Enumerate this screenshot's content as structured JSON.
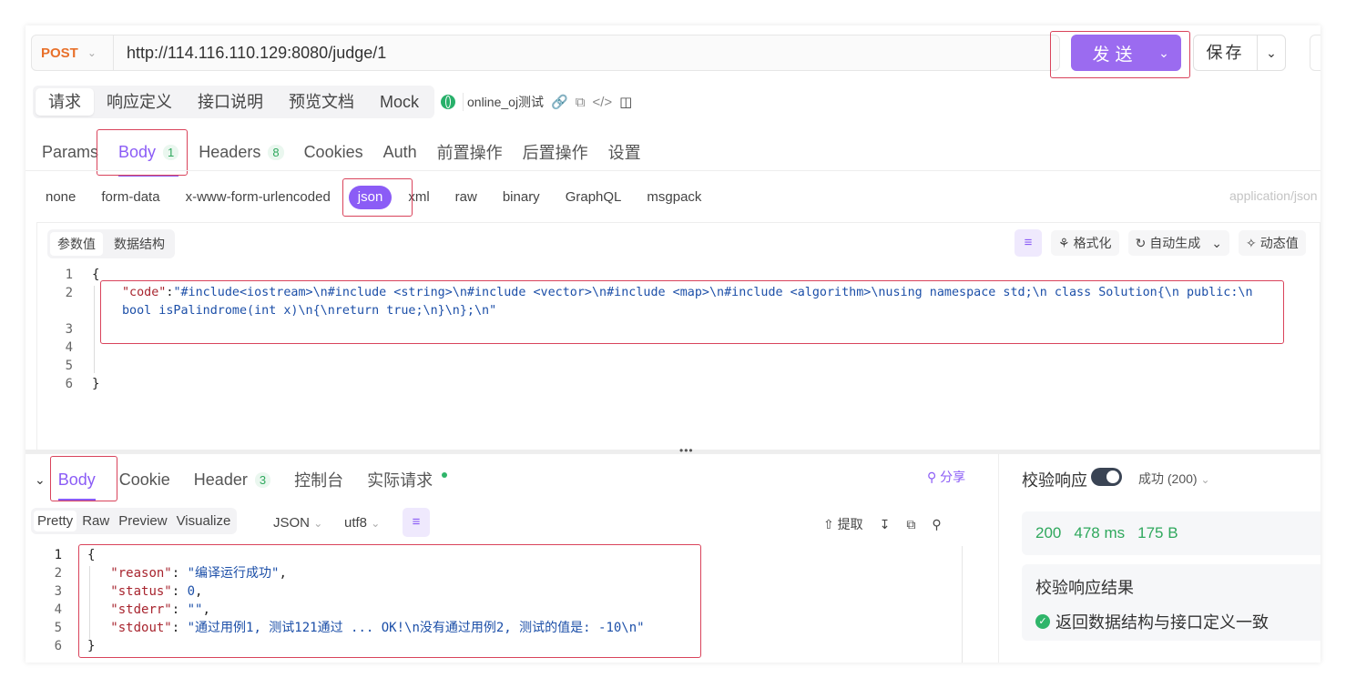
{
  "request": {
    "method": "POST",
    "url": "http://114.116.110.129:8080/judge/1",
    "send_label": "发送",
    "save_label": "保存"
  },
  "top_tabs": [
    "请求",
    "响应定义",
    "接口说明",
    "预览文档",
    "Mock"
  ],
  "environment": "online_oj测试",
  "req_tabs": [
    {
      "label": "Params",
      "badge": ""
    },
    {
      "label": "Body",
      "badge": "1"
    },
    {
      "label": "Headers",
      "badge": "8"
    },
    {
      "label": "Cookies",
      "badge": ""
    },
    {
      "label": "Auth",
      "badge": ""
    },
    {
      "label": "前置操作",
      "badge": ""
    },
    {
      "label": "后置操作",
      "badge": ""
    },
    {
      "label": "设置",
      "badge": ""
    }
  ],
  "body_types": [
    "none",
    "form-data",
    "x-www-form-urlencoded",
    "json",
    "xml",
    "raw",
    "binary",
    "GraphQL",
    "msgpack"
  ],
  "content_type": "application/json",
  "editor": {
    "tabs": [
      "参数值",
      "数据结构"
    ],
    "tools": [
      "格式化",
      "自动生成",
      "动态值"
    ],
    "line_numbers": [
      "1",
      "2",
      "3",
      "4",
      "5",
      "6"
    ],
    "open_brace": "{",
    "close_brace": "}",
    "code_key": "\"code\"",
    "code_value_line1": "\"#include<iostream>\\n#include <string>\\n#include <vector>\\n#include <map>\\n#include <algorithm>\\nusing namespace std;\\n class Solution{\\n public:\\n",
    "code_value_line2": "bool isPalindrome(int x)\\n{\\nreturn true;\\n}\\n};\\n\""
  },
  "response": {
    "tabs": [
      {
        "label": "Body",
        "badge": ""
      },
      {
        "label": "Cookie",
        "badge": ""
      },
      {
        "label": "Header",
        "badge": "3"
      },
      {
        "label": "控制台",
        "badge": ""
      },
      {
        "label": "实际请求",
        "badge": ""
      }
    ],
    "share_label": "分享",
    "view_modes": [
      "Pretty",
      "Raw",
      "Preview",
      "Visualize"
    ],
    "format": "JSON",
    "encoding": "utf8",
    "extract_label": "提取",
    "line_numbers": [
      "1",
      "2",
      "3",
      "4",
      "5",
      "6"
    ],
    "json": {
      "reason_key": "\"reason\"",
      "reason_val": "\"编译运行成功\"",
      "status_key": "\"status\"",
      "status_val": "0",
      "stderr_key": "\"stderr\"",
      "stderr_val": "\"\"",
      "stdout_key": "\"stdout\"",
      "stdout_val": "\"通过用例1, 测试121通过 ... OK!\\n没有通过用例2, 测试的值是: -10\\n\""
    }
  },
  "validation": {
    "title": "校验响应",
    "status": "成功 (200)",
    "code": "200",
    "time": "478 ms",
    "size": "175 B",
    "result_title": "校验响应结果",
    "result_text": "返回数据结构与接口定义一致"
  },
  "colors": {
    "accent": "#8b5cf6",
    "method": "#e8702a",
    "success": "#2fa85d",
    "highlight_box": "#d9435b"
  }
}
